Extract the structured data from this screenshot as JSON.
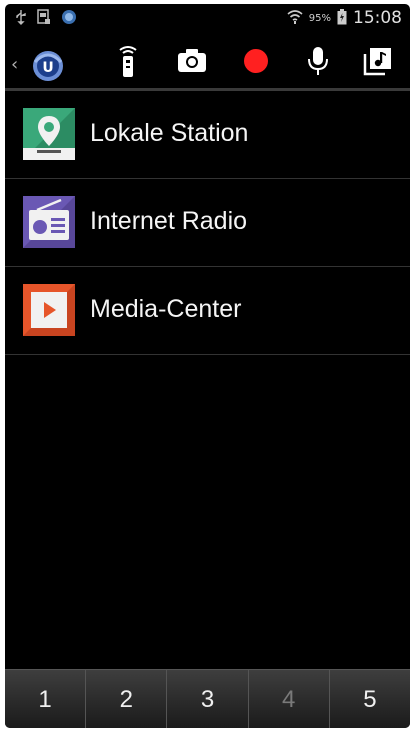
{
  "statusbar": {
    "battery_percent": "95%",
    "time": "15:08",
    "icons": [
      "usb-icon",
      "sim-icon",
      "app-notification-icon",
      "wifi-icon",
      "battery-icon"
    ]
  },
  "actionbar": {
    "logo_letter": "U",
    "buttons": [
      {
        "name": "remote-icon"
      },
      {
        "name": "camera-icon"
      },
      {
        "name": "record-icon",
        "color": "#ff2020"
      },
      {
        "name": "microphone-icon"
      },
      {
        "name": "music-library-icon"
      }
    ]
  },
  "list": {
    "items": [
      {
        "label": "Lokale Station",
        "icon": "map-pin-icon",
        "color": "#3aa87a"
      },
      {
        "label": "Internet Radio",
        "icon": "radio-icon",
        "color": "#6a58b4"
      },
      {
        "label": "Media-Center",
        "icon": "play-icon",
        "color": "#e6552a"
      }
    ]
  },
  "bottombar": {
    "pages": [
      {
        "label": "1",
        "enabled": true
      },
      {
        "label": "2",
        "enabled": true
      },
      {
        "label": "3",
        "enabled": true
      },
      {
        "label": "4",
        "enabled": false
      },
      {
        "label": "5",
        "enabled": true
      }
    ]
  }
}
